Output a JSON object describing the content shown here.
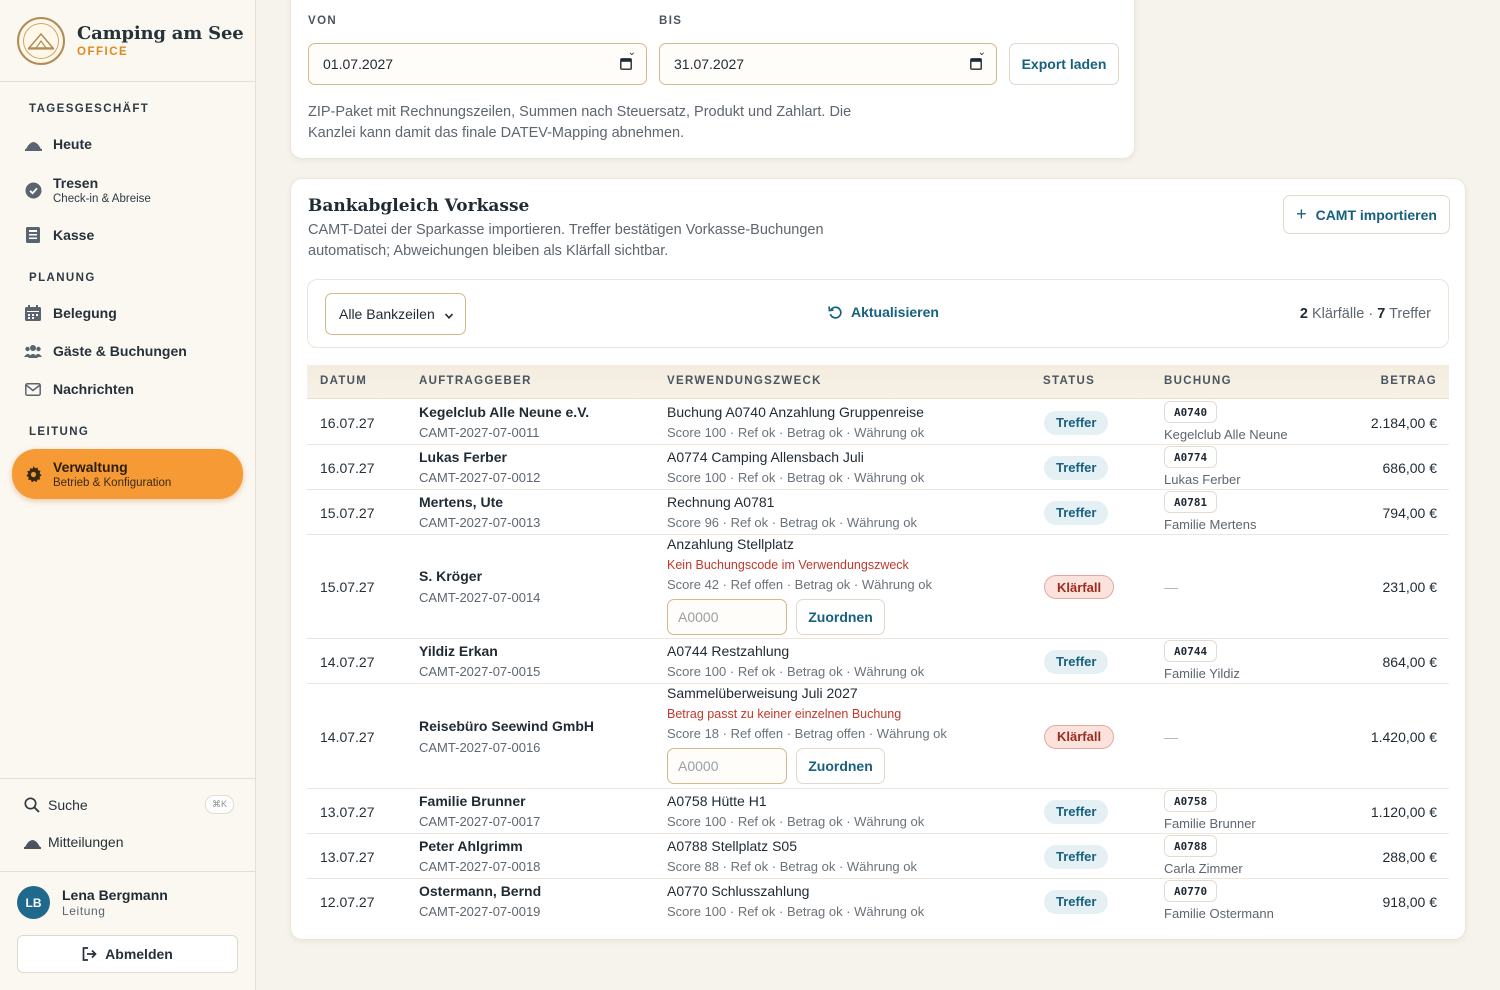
{
  "brand": {
    "title": "Camping am See",
    "subtitle": "OFFICE"
  },
  "sidebar": {
    "sections": [
      {
        "label": "TAGESGESCHÄFT"
      },
      {
        "label": "PLANUNG"
      },
      {
        "label": "LEITUNG"
      }
    ],
    "items": [
      {
        "label": "Heute",
        "icon": "bell-icon"
      },
      {
        "label": "Tresen",
        "sub": "Check-in & Abreise",
        "icon": "check-circle-icon"
      },
      {
        "label": "Kasse",
        "icon": "register-icon"
      },
      {
        "label": "Belegung",
        "icon": "calendar-icon"
      },
      {
        "label": "Gäste & Buchungen",
        "icon": "users-icon"
      },
      {
        "label": "Nachrichten",
        "icon": "mail-icon"
      },
      {
        "label": "Verwaltung",
        "sub": "Betrieb & Konfiguration",
        "icon": "gear-icon",
        "active": true
      }
    ],
    "search": {
      "label": "Suche",
      "shortcut": "⌘K"
    },
    "notifications": {
      "label": "Mitteilungen"
    },
    "user": {
      "initials": "LB",
      "name": "Lena Bergmann",
      "role": "Leitung"
    },
    "logout": {
      "label": "Abmelden"
    }
  },
  "export": {
    "from_label": "VON",
    "to_label": "BIS",
    "from_value": "01.07.2027",
    "to_value": "31.07.2027",
    "button": "Export laden",
    "hint_line1": "ZIP-Paket mit Rechnungszeilen, Summen nach Steuersatz, Produkt und Zahlart. Die",
    "hint_line2": "Kanzlei kann damit das finale DATEV-Mapping abnehmen."
  },
  "bank": {
    "title": "Bankabgleich Vorkasse",
    "desc_line1": "CAMT-Datei der Sparkasse importieren. Treffer bestätigen Vorkasse-Buchungen",
    "desc_line2": "automatisch; Abweichungen bleiben als Klärfall sichtbar.",
    "import_button": "CAMT importieren",
    "filter": "Alle Bankzeilen",
    "refresh": "Aktualisieren",
    "count_klaer": "2",
    "count_klaer_label": "Klärfälle",
    "count_sep": "·",
    "count_treffer": "7",
    "count_treffer_label": "Treffer",
    "columns": [
      "DATUM",
      "AUFTRAGGEBER",
      "VERWENDUNGSZWECK",
      "STATUS",
      "BUCHUNG",
      "BETRAG"
    ],
    "assign_placeholder": "A0000",
    "assign_button": "Zuordnen",
    "no_booking": "—",
    "rows": [
      {
        "date": "16.07.27",
        "name": "Kegelclub Alle Neune e.V.",
        "camt": "CAMT-2027-07-0011",
        "purpose": "Buchung A0740 Anzahlung Gruppenreise",
        "score": "Score 100 · Ref ok · Betrag ok · Währung ok",
        "status": "Treffer",
        "code": "A0740",
        "booking": "Kegelclub Alle Neune",
        "amount": "2.184,00 €"
      },
      {
        "date": "16.07.27",
        "name": "Lukas Ferber",
        "camt": "CAMT-2027-07-0012",
        "purpose": "A0774 Camping Allensbach Juli",
        "score": "Score 100 · Ref ok · Betrag ok · Währung ok",
        "status": "Treffer",
        "code": "A0774",
        "booking": "Lukas Ferber",
        "amount": "686,00 €"
      },
      {
        "date": "15.07.27",
        "name": "Mertens, Ute",
        "camt": "CAMT-2027-07-0013",
        "purpose": "Rechnung A0781",
        "score": "Score 96 · Ref ok · Betrag ok · Währung ok",
        "status": "Treffer",
        "code": "A0781",
        "booking": "Familie Mertens",
        "amount": "794,00 €"
      },
      {
        "date": "15.07.27",
        "name": "S. Kröger",
        "camt": "CAMT-2027-07-0014",
        "purpose": "Anzahlung Stellplatz",
        "warning": "Kein Buchungscode im Verwendungszweck",
        "score": "Score 42 · Ref offen · Betrag ok · Währung ok",
        "status": "Klärfall",
        "amount": "231,00 €"
      },
      {
        "date": "14.07.27",
        "name": "Yildiz Erkan",
        "camt": "CAMT-2027-07-0015",
        "purpose": "A0744 Restzahlung",
        "score": "Score 100 · Ref ok · Betrag ok · Währung ok",
        "status": "Treffer",
        "code": "A0744",
        "booking": "Familie Yildiz",
        "amount": "864,00 €"
      },
      {
        "date": "14.07.27",
        "name": "Reisebüro Seewind GmbH",
        "camt": "CAMT-2027-07-0016",
        "purpose": "Sammelüberweisung Juli 2027",
        "warning": "Betrag passt zu keiner einzelnen Buchung",
        "score": "Score 18 · Ref offen · Betrag offen · Währung ok",
        "status": "Klärfall",
        "amount": "1.420,00 €"
      },
      {
        "date": "13.07.27",
        "name": "Familie Brunner",
        "camt": "CAMT-2027-07-0017",
        "purpose": "A0758 Hütte H1",
        "score": "Score 100 · Ref ok · Betrag ok · Währung ok",
        "status": "Treffer",
        "code": "A0758",
        "booking": "Familie Brunner",
        "amount": "1.120,00 €"
      },
      {
        "date": "13.07.27",
        "name": "Peter Ahlgrimm",
        "camt": "CAMT-2027-07-0018",
        "purpose": "A0788 Stellplatz S05",
        "score": "Score 88 · Ref ok · Betrag ok · Währung ok",
        "status": "Treffer",
        "code": "A0788",
        "booking": "Carla Zimmer",
        "amount": "288,00 €"
      },
      {
        "date": "12.07.27",
        "name": "Ostermann, Bernd",
        "camt": "CAMT-2027-07-0019",
        "purpose": "A0770 Schlusszahlung",
        "score": "Score 100 · Ref ok · Betrag ok · Währung ok",
        "status": "Treffer",
        "code": "A0770",
        "booking": "Familie Ostermann",
        "amount": "918,00 €"
      }
    ]
  },
  "colors": {
    "accent": "#f59a35",
    "link": "#17607f",
    "warning": "#c0392b",
    "background": "#f6f3ec"
  }
}
